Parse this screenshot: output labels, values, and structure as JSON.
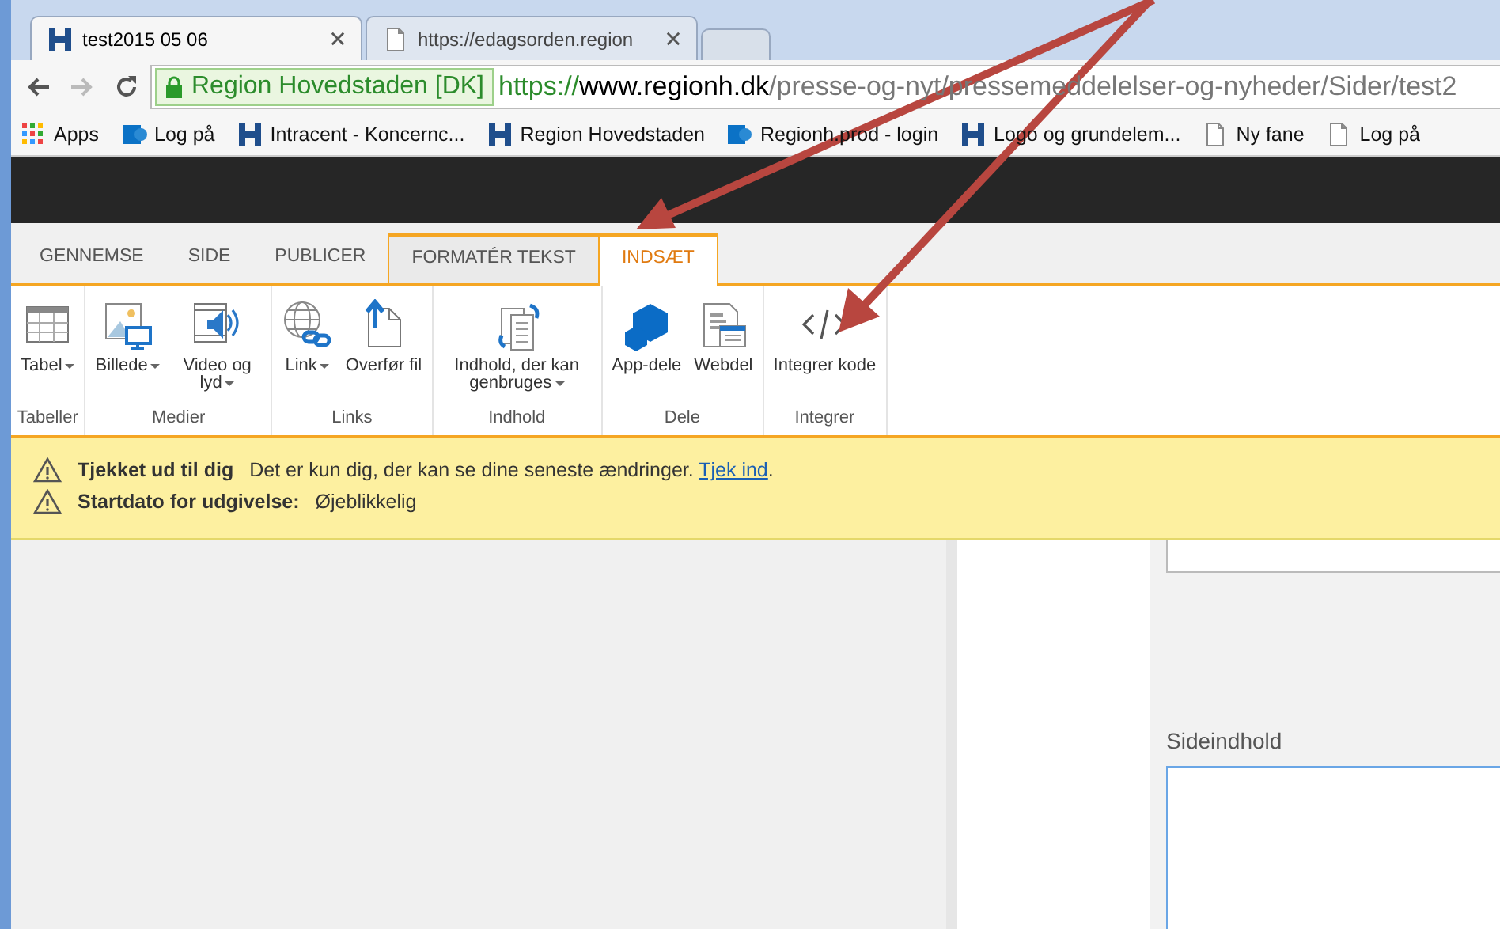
{
  "browser_tabs": [
    {
      "title": "test2015 05 06",
      "kind": "logo",
      "selected": true
    },
    {
      "title": "https://edagsorden.region",
      "kind": "page",
      "selected": false
    }
  ],
  "address_bar": {
    "site_name": "Region Hovedstaden [DK]",
    "scheme": "https://",
    "host": "www.regionh.dk",
    "path": "/presse-og-nyt/pressemeddelelser-og-nyheder/Sider/test2"
  },
  "bookmarks": [
    {
      "label": "Apps",
      "kind": "apps"
    },
    {
      "label": "Log på",
      "kind": "sharepoint"
    },
    {
      "label": "Intracent - Koncernc...",
      "kind": "logo"
    },
    {
      "label": "Region Hovedstaden",
      "kind": "logo"
    },
    {
      "label": "Regionh.prod - login",
      "kind": "sharepoint"
    },
    {
      "label": "Logo og grundelem...",
      "kind": "logo"
    },
    {
      "label": "Ny fane",
      "kind": "page"
    },
    {
      "label": "Log på",
      "kind": "page"
    }
  ],
  "ribbon_tabs": [
    {
      "label": "GENNEMSE",
      "selected": false,
      "contextual": false
    },
    {
      "label": "SIDE",
      "selected": false,
      "contextual": false
    },
    {
      "label": "PUBLICER",
      "selected": false,
      "contextual": false
    },
    {
      "label": "FORMATÉR TEKST",
      "selected": false,
      "contextual": true
    },
    {
      "label": "INDSÆT",
      "selected": true,
      "contextual": true
    }
  ],
  "ribbon_groups": [
    {
      "label": "Tabeller",
      "buttons": [
        {
          "label": "Tabel",
          "kind": "table",
          "dropdown": true
        }
      ]
    },
    {
      "label": "Medier",
      "buttons": [
        {
          "label": "Billede",
          "kind": "image",
          "dropdown": true
        },
        {
          "label": "Video og lyd",
          "kind": "video",
          "dropdown": true
        }
      ]
    },
    {
      "label": "Links",
      "buttons": [
        {
          "label": "Link",
          "kind": "link",
          "dropdown": true
        },
        {
          "label": "Overfør fil",
          "kind": "upload",
          "dropdown": false
        }
      ]
    },
    {
      "label": "Indhold",
      "buttons": [
        {
          "label": "Indhold, der kan genbruges",
          "kind": "reuse",
          "dropdown": true
        }
      ]
    },
    {
      "label": "Dele",
      "buttons": [
        {
          "label": "App-dele",
          "kind": "app",
          "dropdown": false
        },
        {
          "label": "Webdel",
          "kind": "webpart",
          "dropdown": false
        }
      ]
    },
    {
      "label": "Integrer",
      "buttons": [
        {
          "label": "Integrer kode",
          "kind": "code",
          "dropdown": false
        }
      ]
    }
  ],
  "status_messages": [
    {
      "title": "Tjekket ud til dig",
      "text": "Det er kun dig, der kan se dine seneste ændringer.",
      "link": "Tjek ind",
      "after": "."
    },
    {
      "title": "Startdato for udgivelse:",
      "text": "Øjeblikkelig"
    }
  ],
  "content": {
    "field_label": "Sideindhold"
  }
}
